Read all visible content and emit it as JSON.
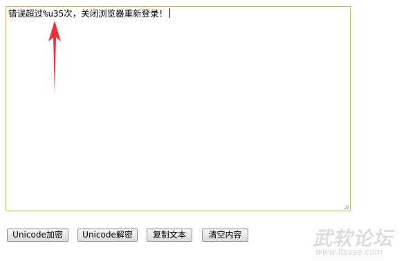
{
  "editor": {
    "text": "错误超过%u35次，关闭浏览器重新登录！"
  },
  "buttons": {
    "encode_label": "Unicode加密",
    "decode_label": "Unicode解密",
    "copy_label": "复制文本",
    "clear_label": "清空内容"
  },
  "annotation": {
    "arrow_color": "#e8313a"
  },
  "watermark": {
    "title": "武软论坛",
    "url": "www.ltsvse.com"
  },
  "colors": {
    "textarea_border": "#d4b24a"
  }
}
